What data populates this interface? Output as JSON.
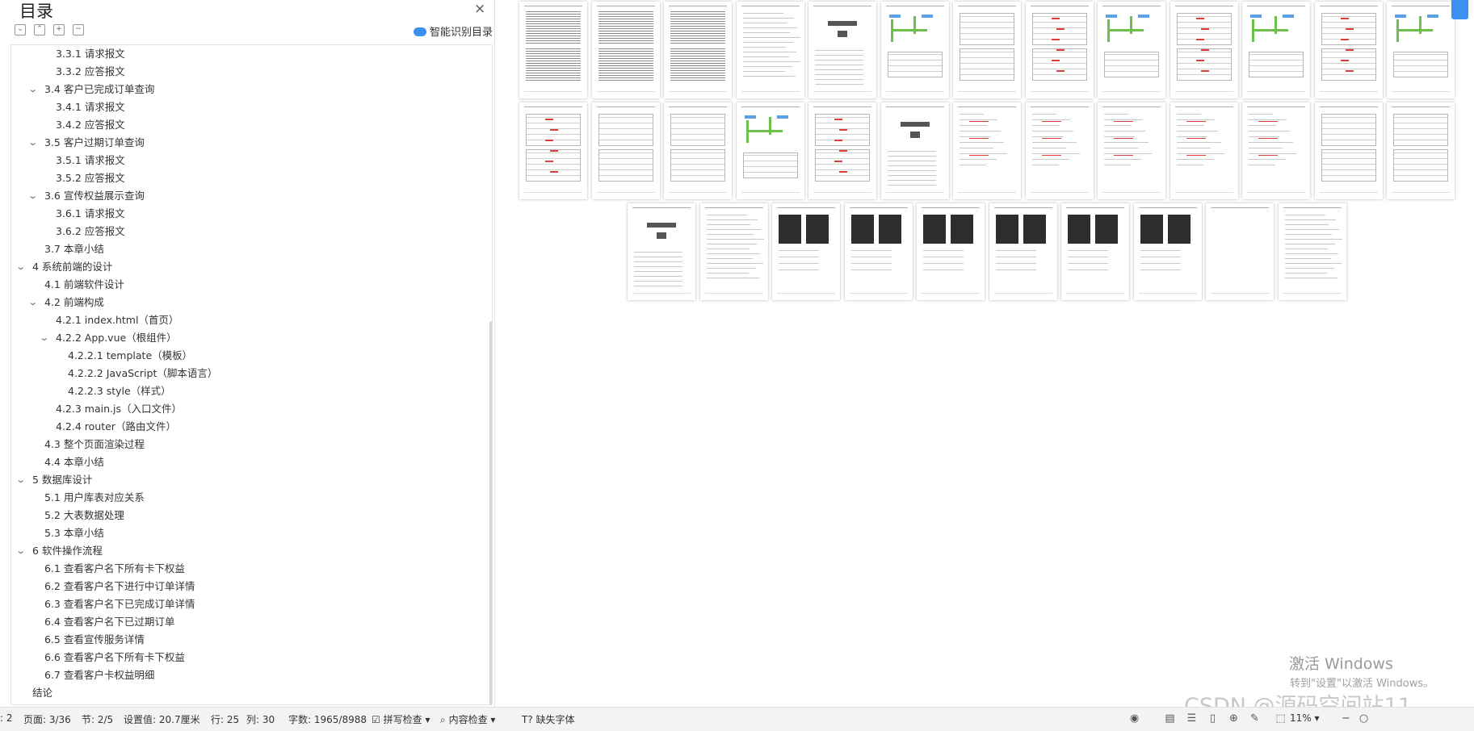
{
  "toc": {
    "title": "目录",
    "close_icon": "×",
    "smart_toc_label": "智能识别目录",
    "items": [
      {
        "label": "3.3.1 请求报文",
        "level": 3,
        "chevron": ""
      },
      {
        "label": "3.3.2 应答报文",
        "level": 3,
        "chevron": ""
      },
      {
        "label": "3.4 客户已完成订单查询",
        "level": 2,
        "chevron": "v"
      },
      {
        "label": "3.4.1 请求报文",
        "level": 3,
        "chevron": ""
      },
      {
        "label": "3.4.2 应答报文",
        "level": 3,
        "chevron": ""
      },
      {
        "label": "3.5 客户过期订单查询",
        "level": 2,
        "chevron": "v"
      },
      {
        "label": "3.5.1 请求报文",
        "level": 3,
        "chevron": ""
      },
      {
        "label": "3.5.2 应答报文",
        "level": 3,
        "chevron": ""
      },
      {
        "label": "3.6 宣传权益展示查询",
        "level": 2,
        "chevron": "v"
      },
      {
        "label": "3.6.1 请求报文",
        "level": 3,
        "chevron": ""
      },
      {
        "label": "3.6.2 应答报文",
        "level": 3,
        "chevron": ""
      },
      {
        "label": "3.7 本章小结",
        "level": 2,
        "chevron": ""
      },
      {
        "label": "4  系统前端的设计",
        "level": 1,
        "chevron": "v"
      },
      {
        "label": "4.1 前端软件设计",
        "level": 2,
        "chevron": ""
      },
      {
        "label": "4.2 前端构成",
        "level": 2,
        "chevron": "v"
      },
      {
        "label": "4.2.1 index.html（首页）",
        "level": 3,
        "chevron": ""
      },
      {
        "label": "4.2.2 App.vue（根组件）",
        "level": 3,
        "chevron": "v"
      },
      {
        "label": "4.2.2.1 template（模板）",
        "level": 4,
        "chevron": ""
      },
      {
        "label": "4.2.2.2 JavaScript（脚本语言）",
        "level": 4,
        "chevron": ""
      },
      {
        "label": "4.2.2.3 style（样式）",
        "level": 4,
        "chevron": ""
      },
      {
        "label": "4.2.3 main.js（入口文件）",
        "level": 3,
        "chevron": ""
      },
      {
        "label": "4.2.4 router（路由文件）",
        "level": 3,
        "chevron": ""
      },
      {
        "label": "4.3  整个页面渲染过程",
        "level": 2,
        "chevron": ""
      },
      {
        "label": "4.4 本章小结",
        "level": 2,
        "chevron": ""
      },
      {
        "label": "5  数据库设计",
        "level": 1,
        "chevron": "v"
      },
      {
        "label": "5.1 用户库表对应关系",
        "level": 2,
        "chevron": ""
      },
      {
        "label": "5.2 大表数据处理",
        "level": 2,
        "chevron": ""
      },
      {
        "label": "5.3 本章小结",
        "level": 2,
        "chevron": ""
      },
      {
        "label": "6  软件操作流程",
        "level": 1,
        "chevron": "v"
      },
      {
        "label": "6.1 查看客户名下所有卡下权益",
        "level": 2,
        "chevron": ""
      },
      {
        "label": "6.2 查看客户名下进行中订单详情",
        "level": 2,
        "chevron": ""
      },
      {
        "label": "6.3 查看客户名下已完成订单详情",
        "level": 2,
        "chevron": ""
      },
      {
        "label": "6.4  查看客户名下已过期订单",
        "level": 2,
        "chevron": ""
      },
      {
        "label": "6.5 查看宣传服务详情",
        "level": 2,
        "chevron": ""
      },
      {
        "label": "6.6 查看客户名下所有卡下权益",
        "level": 2,
        "chevron": ""
      },
      {
        "label": "6.7 查看客户卡权益明细",
        "level": 2,
        "chevron": ""
      },
      {
        "label": "结论",
        "level": 1,
        "chevron": ""
      }
    ]
  },
  "thumbnails": {
    "row_1_count": 13,
    "row_2_count": 13,
    "row_3_count": 10
  },
  "watermark": {
    "title": "激活 Windows",
    "subtitle": "转到\"设置\"以激活 Windows。",
    "csdn": "CSDN @源码空间站11"
  },
  "status": {
    "section_prefix": ": 2",
    "page": "页面: 3/36",
    "section": "节: 2/5",
    "setting": "设置值: 20.7厘米",
    "row": "行: 25",
    "col": "列: 30",
    "word_count": "字数: 1965/8988",
    "spell_check": "拼写检查",
    "content_check": "内容检查",
    "missing_font": "缺失字体",
    "zoom": "11%"
  },
  "colors": {
    "accent": "#3d8ff0",
    "table_red": "#e03b3b",
    "diagram_green": "#6cc04a"
  }
}
